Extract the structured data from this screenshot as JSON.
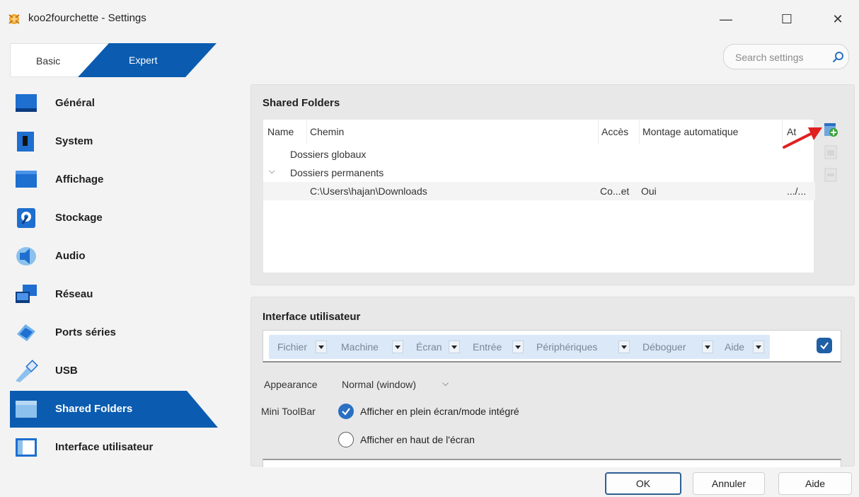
{
  "window": {
    "title": "koo2fourchette - Settings",
    "controls": {
      "minimize": "—",
      "maximize": "☐",
      "close": "✕"
    }
  },
  "mode_tabs": {
    "basic": "Basic",
    "expert": "Expert",
    "selected": "Expert"
  },
  "search": {
    "placeholder": "Search settings"
  },
  "sidebar": {
    "items": [
      {
        "label": "Général",
        "icon": "general-icon"
      },
      {
        "label": "System",
        "icon": "system-icon"
      },
      {
        "label": "Affichage",
        "icon": "display-icon"
      },
      {
        "label": "Stockage",
        "icon": "storage-icon"
      },
      {
        "label": "Audio",
        "icon": "audio-icon"
      },
      {
        "label": "Réseau",
        "icon": "network-icon"
      },
      {
        "label": "Ports séries",
        "icon": "serial-ports-icon"
      },
      {
        "label": "USB",
        "icon": "usb-icon"
      },
      {
        "label": "Shared Folders",
        "icon": "shared-folders-icon"
      },
      {
        "label": "Interface utilisateur",
        "icon": "user-interface-icon"
      }
    ],
    "active": "Shared Folders"
  },
  "shared_folders": {
    "title": "Shared Folders",
    "columns": [
      "Name",
      "Chemin",
      "Accès",
      "Montage automatique",
      "At"
    ],
    "global_group": "Dossiers globaux",
    "permanent_group": "Dossiers permanents",
    "rows": [
      {
        "path": "C:\\Users\\hajan\\Downloads",
        "access": "Co...et",
        "auto_mount": "Oui",
        "at": ".../..."
      }
    ],
    "tools": [
      "add-shared-folder-icon",
      "edit-shared-folder-icon",
      "remove-shared-folder-icon"
    ]
  },
  "user_interface": {
    "title": "Interface utilisateur",
    "menu_items": [
      "Fichier",
      "Machine",
      "Écran",
      "Entrée",
      "Périphériques",
      "Déboguer",
      "Aide"
    ],
    "menu_bar_enabled": true,
    "appearance_label": "Appearance",
    "appearance_value": "Normal (window)",
    "mini_toolbar_label": "Mini ToolBar",
    "option_fullscreen": "Afficher en plein écran/mode intégré",
    "option_fullscreen_checked": true,
    "option_top": "Afficher en haut de l'écran",
    "option_top_checked": false
  },
  "buttons": {
    "ok": "OK",
    "cancel": "Annuler",
    "help": "Aide"
  },
  "colors": {
    "accent": "#0b5cb0",
    "panel_bg": "#e8e8e8",
    "arrow": "#e02020",
    "add_icon": "#3aa33a"
  }
}
